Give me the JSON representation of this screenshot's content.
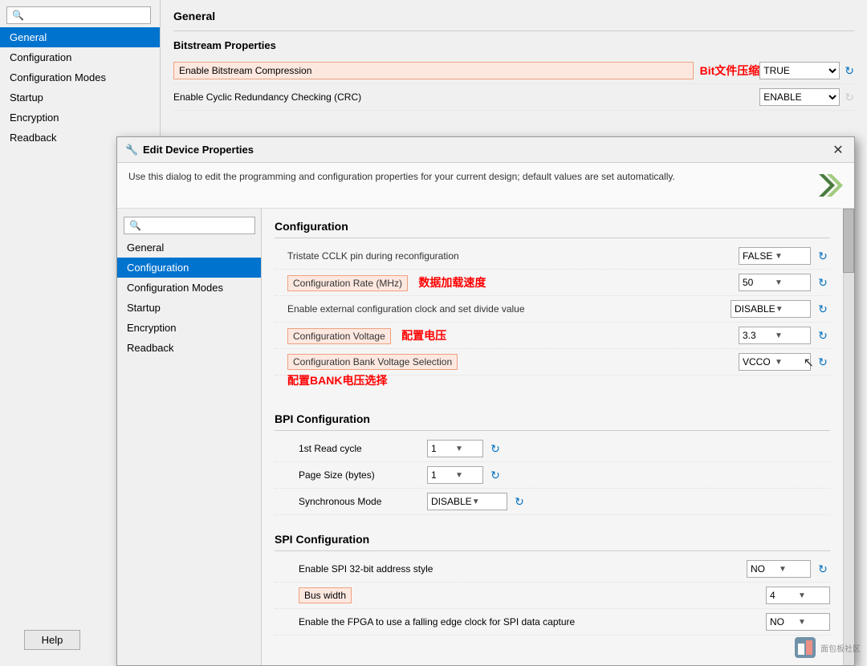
{
  "background": {
    "sidebar": {
      "search_placeholder": "🔍",
      "nav_items": [
        {
          "label": "General",
          "active": true
        },
        {
          "label": "Configuration",
          "active": false
        },
        {
          "label": "Configuration Modes",
          "active": false
        },
        {
          "label": "Startup",
          "active": false
        },
        {
          "label": "Encryption",
          "active": false
        },
        {
          "label": "Readback",
          "active": false
        }
      ],
      "help_label": "Help"
    },
    "main": {
      "section_title": "General",
      "bitstream_title": "Bitstream Properties",
      "rows": [
        {
          "label": "Enable Bitstream Compression",
          "chinese": "Bit文件压缩",
          "value": "TRUE",
          "highlighted": true
        },
        {
          "label": "Enable Cyclic Redundancy Checking (CRC)",
          "value": "ENABLE",
          "highlighted": false
        }
      ]
    }
  },
  "modal": {
    "title": "Edit Device Properties",
    "close_icon": "✕",
    "description": "Use this dialog to edit the programming and configuration properties for your current design; default values are set automatically.",
    "sidebar": {
      "search_placeholder": "🔍",
      "nav_items": [
        {
          "label": "General",
          "active": false
        },
        {
          "label": "Configuration",
          "active": true
        },
        {
          "label": "Configuration Modes",
          "active": false
        },
        {
          "label": "Startup",
          "active": false
        },
        {
          "label": "Encryption",
          "active": false
        },
        {
          "label": "Readback",
          "active": false
        }
      ]
    },
    "configuration": {
      "section_title": "Configuration",
      "rows": [
        {
          "label": "Tristate CCLK pin during reconfiguration",
          "value": "FALSE",
          "highlighted": false,
          "has_refresh": true,
          "chinese": ""
        },
        {
          "label": "Configuration Rate (MHz)",
          "value": "50",
          "highlighted": true,
          "has_refresh": true,
          "chinese": "数据加载速度"
        },
        {
          "label": "Enable external configuration clock and set divide value",
          "value": "DISABLE",
          "highlighted": false,
          "has_refresh": true,
          "chinese": ""
        },
        {
          "label": "Configuration Voltage",
          "value": "3.3",
          "highlighted": true,
          "has_refresh": true,
          "chinese": "配置电压"
        },
        {
          "label": "Configuration Bank Voltage Selection",
          "value": "VCCO",
          "highlighted": true,
          "has_refresh": true,
          "chinese": ""
        }
      ],
      "bank_voltage_chinese": "配置BANK电压选择"
    },
    "bpi_section": {
      "title": "BPI Configuration",
      "rows": [
        {
          "label": "1st Read cycle",
          "value": "1",
          "has_refresh": true
        },
        {
          "label": "Page Size (bytes)",
          "value": "1",
          "has_refresh": true
        },
        {
          "label": "Synchronous Mode",
          "value": "DISABLE",
          "has_refresh": true
        }
      ]
    },
    "spi_section": {
      "title": "SPI Configuration",
      "rows": [
        {
          "label": "Enable SPI 32-bit address style",
          "value": "NO",
          "has_refresh": true,
          "highlighted": false
        },
        {
          "label": "Bus width",
          "value": "4",
          "has_refresh": false,
          "highlighted": true
        },
        {
          "label": "Enable the FPGA to use a falling edge clock for SPI data capture",
          "value": "NO",
          "has_refresh": false,
          "highlighted": false
        }
      ]
    }
  }
}
